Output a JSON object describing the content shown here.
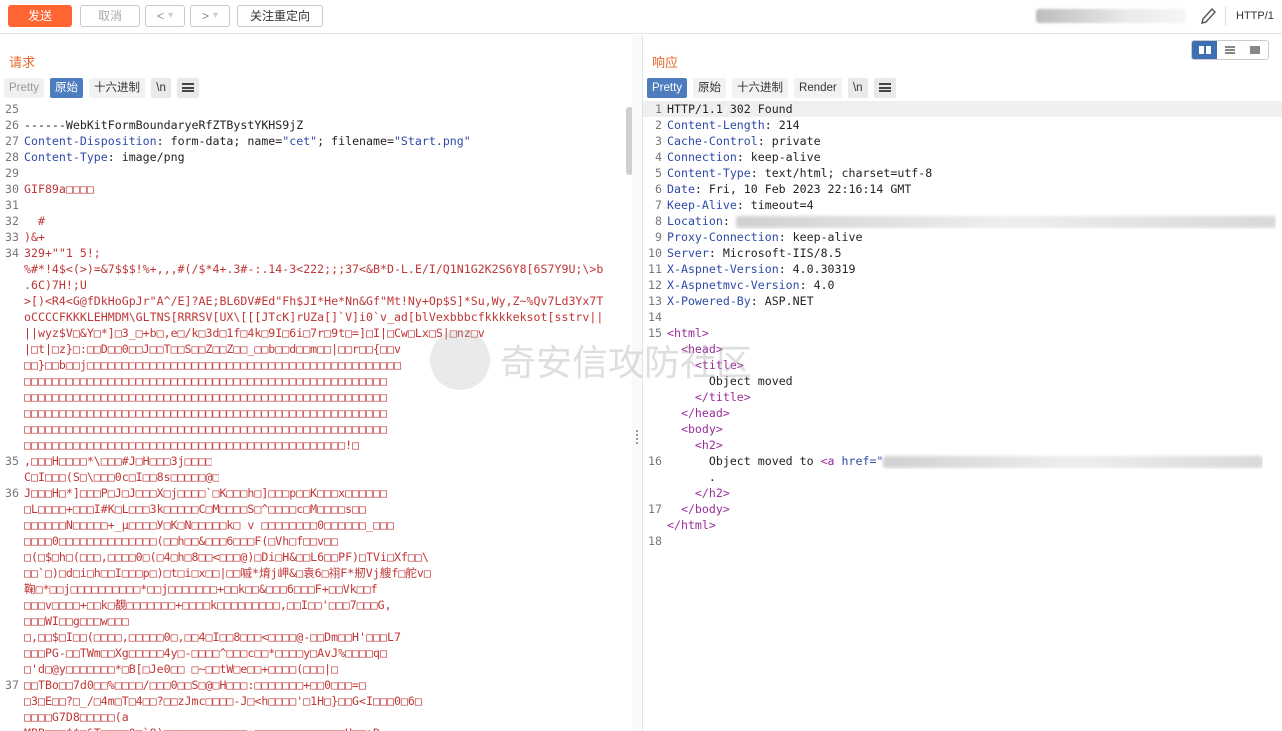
{
  "toolbar": {
    "send": "发送",
    "cancel": "取消",
    "back": "<",
    "forward": ">",
    "dropdown": "▾",
    "follow_redirect": "关注重定向",
    "http_version": "HTTP/1"
  },
  "request": {
    "title": "请求",
    "tabs": [
      "Pretty",
      "原始",
      "十六进制",
      "\\n"
    ],
    "active_tab": "原始",
    "lines": [
      {
        "n": "25",
        "text": ""
      },
      {
        "n": "26",
        "text": "------WebKitFormBoundaryeRfZTBystYKHS9jZ"
      },
      {
        "n": "27",
        "h": "Content-Disposition",
        "rest": ": form-data; name=",
        "s1": "\"cet\"",
        "mid": "; filename=",
        "s2": "\"Start.png\""
      },
      {
        "n": "28",
        "h": "Content-Type",
        "rest": ": image/png"
      },
      {
        "n": "29",
        "text": ""
      },
      {
        "n": "30",
        "red": "GIF89a□□□□"
      },
      {
        "n": "31",
        "text": ""
      },
      {
        "n": "32",
        "red": "  #"
      },
      {
        "n": "33",
        "red": ")&+"
      },
      {
        "n": "34",
        "red": "329+\"\"1 5!;"
      },
      {
        "n": "",
        "red": "%#*!4$<(>)=&7$$$!%+,,,#(/$*4+.3#-:.14-3<222;;;37<&B*D-L.E/I/Q1N1G2K2S6Y8[6S7Y9U;\\>b"
      },
      {
        "n": "",
        "red": ".6C)7H!;U"
      },
      {
        "n": "",
        "red": ">[)<R4<G@fDkHoGpJr\"A^/E]?AE;BL6DV#Ed\"Fh$JI*He*Nn&Gf\"Mt!Ny+Op$S]*Su,Wy,Z~%Qv7Ld3Yx7T"
      },
      {
        "n": "",
        "red": "oCCCCFKKKLEHMDM\\GLTNS[RRRSV[UX\\[[[JTcK]rUZa[]`V]i0`v_ad[blVexbbbcfkkkkeksot[sstrv||"
      },
      {
        "n": "",
        "red": "||wyz$V□&Y□*]□3_□+b□,e□/k□3d□1f□4k□9I□6i□7r□9t□=]□I|□Cw□Lx□S|□nz□v"
      },
      {
        "n": "",
        "red": "|□t|□z}□:□□D□□0□□J□□T□□S□□Z□□Z□□_□□b□□d□□m□□|□□r□□{□□v"
      },
      {
        "n": "",
        "red": "□□}□□b□□j□□□□□□□□□□□□□□□□□□□□□□□□□□□□□□□□□□□□□□□□□□□□□"
      },
      {
        "n": "",
        "red": "□□□□□□□□□□□□□□□□□□□□□□□□□□□□□□□□□□□□□□□□□□□□□□□□□□□□"
      },
      {
        "n": "",
        "red": "□□□□□□□□□□□□□□□□□□□□□□□□□□□□□□□□□□□□□□□□□□□□□□□□□□□□"
      },
      {
        "n": "",
        "red": "□□□□□□□□□□□□□□□□□□□□□□□□□□□□□□□□□□□□□□□□□□□□□□□□□□□□"
      },
      {
        "n": "",
        "red": "□□□□□□□□□□□□□□□□□□□□□□□□□□□□□□□□□□□□□□□□□□□□□□□□□□□□"
      },
      {
        "n": "",
        "red": "□□□□□□□□□□□□□□□□□□□□□□□□□□□□□□□□□□□□□□□□□□□□□□!□"
      },
      {
        "n": "35",
        "red": ",□□□H□□□□*\\□□□#J□H□□□3j□□□□"
      },
      {
        "n": "",
        "red": "C□I□□□(S□\\□□□0c□I□□8s□□□□□@□"
      },
      {
        "n": "36",
        "red": "J□□□H□*]□□□P□J□J□□□X□j□□□□`□K□□□h□]□□□p□□K□□□x□□□□□□"
      },
      {
        "n": "",
        "red": "□L□□□□+□□□I#K□L□□□3k□□□□□C□M□□□□S□^□□□□c□M□□□□s□□"
      },
      {
        "n": "",
        "red": "□□□□□□N□□□□□+_μ□□□□У□K□N□□□□□k□ v □□□□□□□□0□□□□□□_□□□"
      },
      {
        "n": "",
        "red": "□□□□0□□□□□□□□□□□□□□(□□h□□&□□□6□□□F(□Vh□f□□v□□"
      },
      {
        "n": "",
        "red": "□(□$□h□(□□□,□□□□0□(□4□h□8□□<□□□@)□Di□H&□□L6□□PF)□TVi□Xf□□\\"
      },
      {
        "n": "",
        "red": "□□`□)□d□i□h□□I□□□p□)□t□i□x□□|□□嘁*焴j岬&□袁6□祤F*剏Vj艘f□舵v□"
      },
      {
        "n": "",
        "red": "鞠□*□□j□□□□□□□□□□*□□j□□□□□□□+□□k□□&□□□6□□□F+□□Vk□□f"
      },
      {
        "n": "",
        "red": "□□□v□□□□+□□k□覩□□□□□□□+□□□□k□□□□□□□□□,□□I□□'□□□7□□□G,"
      },
      {
        "n": "",
        "red": "□□□WI□□g□□□w□□□"
      },
      {
        "n": "",
        "red": "□,□□$□I□□(□□□□,□□□□□0□,□□4□I□□8□□□<□□□□@-□□Dm□□H'□□□L7"
      },
      {
        "n": "",
        "red": "□□□PG-□□TWm□□Xg□□□□□4y□-□□□□^□□□c□□*□□□□y□AvJ%□□□□q□"
      },
      {
        "n": "",
        "red": "□'d□@y□□□□□□□*□B[□Je0□□ □~□□tW□e□□+□□□□(□□□|□"
      },
      {
        "n": "37",
        "red": "□□TBo□□7d0□□%□□□□/□□□0□□S□@□H□□□:□□□□□□□+□□0□□□=□"
      },
      {
        "n": "",
        "red": "□3□E□□?□_/□4m□T□4□□?□□zJmc□□□□-J□<h□□□□'□1H□}□□G<I□□□0□6□"
      },
      {
        "n": "",
        "red": "□□□□G7D8□□□□□(a"
      },
      {
        "n": "",
        "red": "MBB□□□$$□&T□□□□0□`8)□□□□□□□□□□□□+□□□□□□□□□□□□□H□□aD"
      }
    ]
  },
  "response": {
    "title": "响应",
    "tabs": [
      "Pretty",
      "原始",
      "十六进制",
      "Render",
      "\\n"
    ],
    "active_tab": "Pretty",
    "headers": [
      {
        "n": "1",
        "text": "HTTP/1.1 302 Found"
      },
      {
        "n": "2",
        "h": "Content-Length",
        "v": ": 214"
      },
      {
        "n": "3",
        "h": "Cache-Control",
        "v": ": private"
      },
      {
        "n": "4",
        "h": "Connection",
        "v": ": keep-alive"
      },
      {
        "n": "5",
        "h": "Content-Type",
        "v": ": text/html; charset=utf-8"
      },
      {
        "n": "6",
        "h": "Date",
        "v": ": Fri, 10 Feb 2023 22:16:14 GMT"
      },
      {
        "n": "7",
        "h": "Keep-Alive",
        "v": ": timeout=4"
      },
      {
        "n": "8",
        "h": "Location",
        "v": ":"
      },
      {
        "n": "9",
        "h": "Proxy-Connection",
        "v": ": keep-alive"
      },
      {
        "n": "10",
        "h": "Server",
        "v": ": Microsoft-IIS/8.5"
      },
      {
        "n": "11",
        "h": "X-Aspnet-Version",
        "v": ": 4.0.30319"
      },
      {
        "n": "12",
        "h": "X-Aspnetmvc-Version",
        "v": ": 4.0"
      },
      {
        "n": "13",
        "h": "X-Powered-By",
        "v": ": ASP.NET"
      },
      {
        "n": "14",
        "text": ""
      }
    ],
    "body": {
      "html_open": "<html>",
      "head_open": "<head>",
      "title_open": "<title>",
      "title_text": "Object moved",
      "title_close": "</title>",
      "head_close": "</head>",
      "body_open": "<body>",
      "h2_open": "<h2>",
      "h2_text": "Object moved to ",
      "a_open": "<a",
      "href_attr": "href",
      "href_val": "=\"",
      "h2_close": "</h2>",
      "dot": ".",
      "body_close": "</body>",
      "html_close": "</html>",
      "line_numbers": [
        "15",
        "16",
        "17",
        "18"
      ]
    }
  },
  "watermark": "奇安信攻防社区",
  "colors": {
    "accent": "#ff6633",
    "tab_active": "#4d7dbf",
    "title": "#e8692a",
    "binary_text": "#c03636",
    "header_name": "#2f4aa8",
    "tag": "#9b2d9b"
  }
}
